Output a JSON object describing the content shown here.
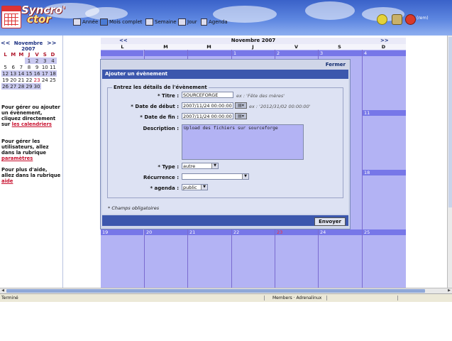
{
  "header": {
    "logo_line1": "Syncro'",
    "logo_line2": "ctor",
    "nav": [
      "Année",
      "Mois complet",
      "Semaine",
      "Jour",
      "Agenda"
    ],
    "user": "(rem)"
  },
  "sidebar": {
    "prev": "<<",
    "next": ">>",
    "month": "Novembre",
    "year": "2007",
    "dow": [
      "L",
      "M",
      "M",
      "J",
      "V",
      "S",
      "D"
    ],
    "weeks": [
      [
        "",
        "",
        "",
        "1",
        "2",
        "3",
        "4"
      ],
      [
        "5",
        "6",
        "7",
        "8",
        "9",
        "10",
        "11"
      ],
      [
        "12",
        "13",
        "14",
        "15",
        "16",
        "17",
        "18"
      ],
      [
        "19",
        "20",
        "21",
        "22",
        "23",
        "24",
        "25"
      ],
      [
        "26",
        "27",
        "28",
        "29",
        "30",
        "",
        ""
      ]
    ],
    "help": [
      {
        "pre": "Pour gérer ou ajouter un évènement, cliquez directement sur ",
        "link": "les calendriers",
        "post": ""
      },
      {
        "pre": "Pour gérer les utilisateurs, allez dans la rubrique ",
        "link": "paramètres",
        "post": ""
      },
      {
        "pre": "Pour plus d'aide, allez dans la rubrique ",
        "link": "aide",
        "post": ""
      }
    ]
  },
  "calendar": {
    "prev": "<<",
    "next": ">>",
    "title": "Novembre 2007",
    "dow": [
      "L",
      "M",
      "M",
      "J",
      "V",
      "S",
      "D"
    ],
    "week1": [
      "",
      "",
      "",
      "1",
      "2",
      "3",
      "4"
    ],
    "right_nums": [
      "11",
      "18"
    ],
    "last_week": [
      "19",
      "20",
      "21",
      "22",
      "23",
      "24",
      "25"
    ]
  },
  "modal": {
    "close": "Fermer",
    "title": "Ajouter un évènement",
    "legend": "Entrez les détails de l'évènement",
    "title_label": "* Titre :",
    "title_value": "SOURCEFORGE",
    "title_hint": "ex : 'Fête des mères'",
    "start_label": "* Date de début :",
    "start_value": "2007/11/24 00:00:00",
    "start_hint": "ex : '2012/31/02 00:00:00'",
    "end_label": "* Date de fin :",
    "end_value": "2007/11/24 00:00:00",
    "desc_label": "Description :",
    "desc_value": "Upload des fichiers sur sourceforge",
    "type_label": "* Type :",
    "type_value": "autre",
    "recur_label": "Récurrence :",
    "recur_value": "",
    "agenda_label": "* agenda :",
    "agenda_value": "public",
    "required_note": "* Champs obligatoires",
    "submit": "Envoyer"
  },
  "status": {
    "left": "Terminé",
    "mid": "Members · Adrenalinux"
  },
  "colors": {
    "accent": "#3c57ad",
    "calendar_bg": "#b3b3f4",
    "day_header": "#7777e8",
    "link_red": "#c8102e"
  }
}
